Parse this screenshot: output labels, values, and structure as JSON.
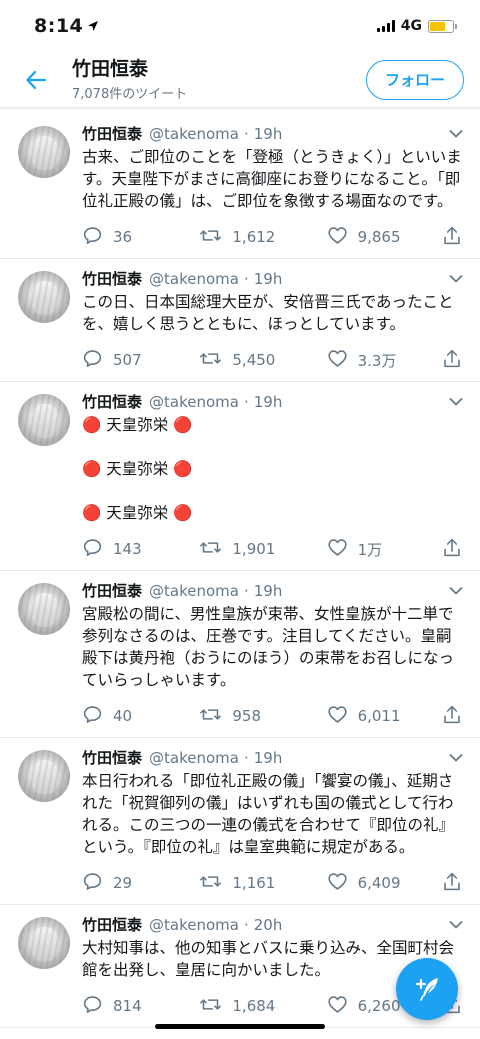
{
  "status_bar": {
    "time": "8:14",
    "network": "4G",
    "battery_color": "#f5c400"
  },
  "header": {
    "title": "竹田恒泰",
    "subtitle": "7,078件のツイート",
    "follow_label": "フォロー"
  },
  "accent_color": "#1da1f2",
  "tweets": [
    {
      "name": "竹田恒泰",
      "handle": "@takenoma",
      "time": "19h",
      "text": "古来、ご即位のことを「登極（とうきょく）」といいます。天皇陛下がまさに高御座にお登りになること。「即位礼正殿の儀」は、ご即位を象徴する場面なのです。",
      "replies": "36",
      "retweets": "1,612",
      "likes": "9,865"
    },
    {
      "name": "竹田恒泰",
      "handle": "@takenoma",
      "time": "19h",
      "text": "この日、日本国総理大臣が、安倍晋三氏であったことを、嬉しく思うとともに、ほっとしています。",
      "replies": "507",
      "retweets": "5,450",
      "likes": "3.3万"
    },
    {
      "name": "竹田恒泰",
      "handle": "@takenoma",
      "time": "19h",
      "text": "🔴 天皇弥栄 🔴\n\n🔴 天皇弥栄 🔴\n\n🔴 天皇弥栄 🔴",
      "replies": "143",
      "retweets": "1,901",
      "likes": "1万"
    },
    {
      "name": "竹田恒泰",
      "handle": "@takenoma",
      "time": "19h",
      "text": "宮殿松の間に、男性皇族が束帯、女性皇族が十二単で参列なさるのは、圧巻です。注目してください。皇嗣殿下は黄丹袍（おうにのほう）の束帯をお召しになっていらっしゃいます。",
      "replies": "40",
      "retweets": "958",
      "likes": "6,011"
    },
    {
      "name": "竹田恒泰",
      "handle": "@takenoma",
      "time": "19h",
      "text": "本日行われる「即位礼正殿の儀」「饗宴の儀」、延期された「祝賀御列の儀」はいずれも国の儀式として行われる。この三つの一連の儀式を合わせて『即位の礼』という。『即位の礼』は皇室典範に規定がある。",
      "replies": "29",
      "retweets": "1,161",
      "likes": "6,409"
    },
    {
      "name": "竹田恒泰",
      "handle": "@takenoma",
      "time": "20h",
      "text": "大村知事は、他の知事とバスに乗り込み、全国町村会館を出発し、皇居に向かいました。",
      "replies": "814",
      "retweets": "1,684",
      "likes": "6,260"
    }
  ]
}
